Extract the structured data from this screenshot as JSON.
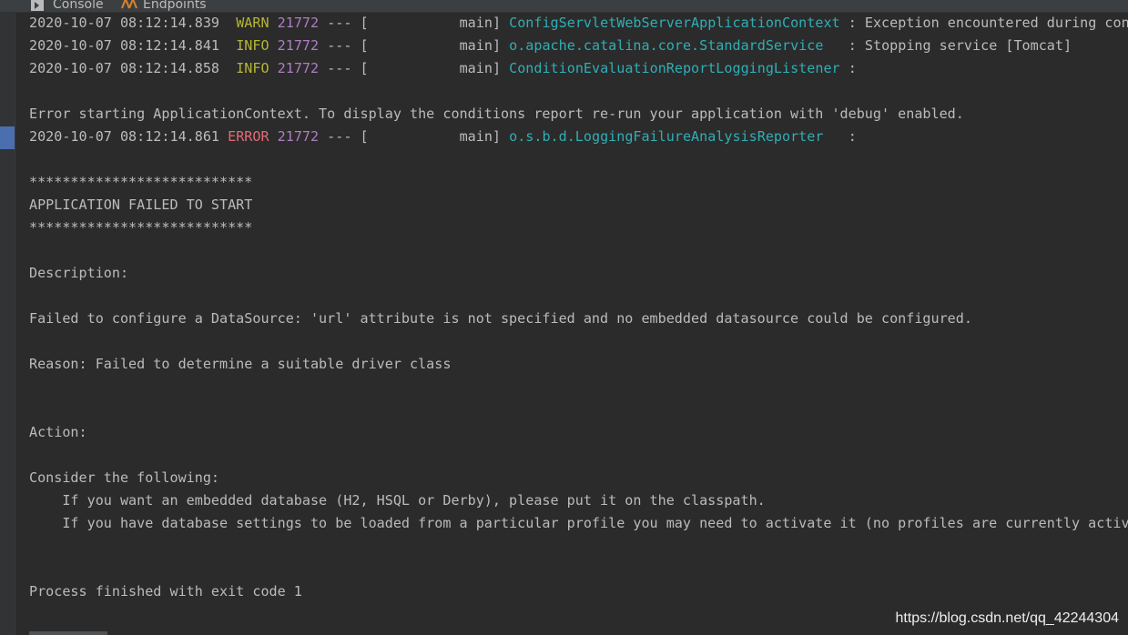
{
  "tabs": {
    "console": "Console",
    "endpoints": "Endpoints"
  },
  "log": {
    "warn_line": {
      "timestamp": "2020-10-07 08:12:14.839",
      "level": "WARN",
      "pid": "21772",
      "sep": "---",
      "thread": "[           main]",
      "logger": "ConfigServletWebServerApplicationContext",
      "message": " : Exception encountered during cont"
    },
    "info_line_1": {
      "timestamp": "2020-10-07 08:12:14.841",
      "level": "INFO",
      "pid": "21772",
      "sep": "---",
      "thread": "[           main]",
      "logger": "o.apache.catalina.core.StandardService",
      "message": "   : Stopping service [Tomcat]"
    },
    "info_line_2": {
      "timestamp": "2020-10-07 08:12:14.858",
      "level": "INFO",
      "pid": "21772",
      "sep": "---",
      "thread": "[           main]",
      "logger": "ConditionEvaluationReportLoggingListener",
      "message": " :"
    },
    "error_starting": "Error starting ApplicationContext. To display the conditions report re-run your application with 'debug' enabled.",
    "error_line": {
      "timestamp": "2020-10-07 08:12:14.861",
      "level": "ERROR",
      "pid": "21772",
      "sep": "---",
      "thread": "[           main]",
      "logger": "o.s.b.d.LoggingFailureAnalysisReporter",
      "message": "   :"
    },
    "stars": "***************************",
    "failed_title": "APPLICATION FAILED TO START",
    "description_label": "Description:",
    "description_text": "Failed to configure a DataSource: 'url' attribute is not specified and no embedded datasource could be configured.",
    "reason": "Reason: Failed to determine a suitable driver class",
    "action_label": "Action:",
    "consider": "Consider the following:",
    "suggestion_1": "    If you want an embedded database (H2, HSQL or Derby), please put it on the classpath.",
    "suggestion_2": "    If you have database settings to be loaded from a particular profile you may need to activate it (no profiles are currently active",
    "exit": "Process finished with exit code 1"
  },
  "watermark": "https://blog.csdn.net/qq_42244304",
  "colors": {
    "background": "#2b2b2b",
    "text": "#bbbbbb",
    "level_warn_info": "#b5b634",
    "level_error": "#e06c75",
    "pid": "#b07cc6",
    "logger": "#2faeb6"
  }
}
